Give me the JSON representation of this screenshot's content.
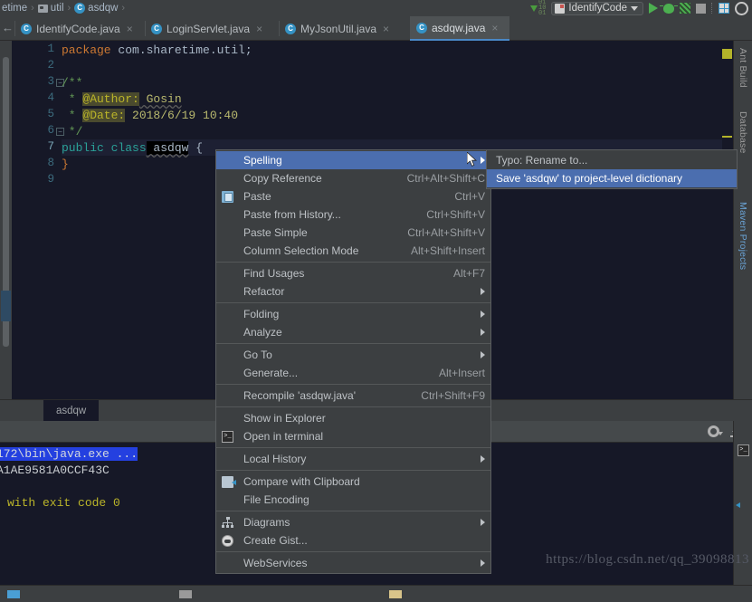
{
  "window": {
    "theme_bg": "#3c3f41",
    "editor_bg": "#161827",
    "accent": "#4b6eaf",
    "tab_accent": "#4a88c7"
  },
  "breadcrumb": {
    "items": [
      {
        "label": "etime",
        "icon": "none"
      },
      {
        "label": "util",
        "icon": "folder-icon"
      },
      {
        "label": "asdqw",
        "icon": "class-icon"
      }
    ],
    "separator": "›"
  },
  "toolbar": {
    "binary_icon": "binary-download-icon",
    "run_config": {
      "name": "IdentifyCode",
      "dropdown": "▼"
    },
    "run_button": "run-icon",
    "debug_button": "debug-icon",
    "coverage_button": "run-with-coverage-icon",
    "stop_button": "stop-icon",
    "layout_button": "grid-layout-icon",
    "search_button": "search-icon"
  },
  "tabs": {
    "back_arrow": "←",
    "items": [
      {
        "label": "IdentifyCode.java",
        "icon": "class-icon",
        "active": false,
        "close": "×"
      },
      {
        "label": "LoginServlet.java",
        "icon": "class-icon",
        "active": false,
        "close": "×"
      },
      {
        "label": "MyJsonUtil.java",
        "icon": "class-icon",
        "active": false,
        "close": "×"
      },
      {
        "label": "asdqw.java",
        "icon": "class-icon",
        "active": true,
        "close": "×"
      }
    ]
  },
  "editor": {
    "line_numbers": [
      "1",
      "2",
      "3",
      "4",
      "5",
      "6",
      "7",
      "8",
      "9"
    ],
    "current_line": 7,
    "code": {
      "l1_kw": "package",
      "l1_pkg": " com.sharetime.util;",
      "l3_doc": "/**",
      "l4_star": " * ",
      "l4_tag": "@Author:",
      "l4_val": " Gosin",
      "l5_star": " * ",
      "l5_tag": "@Date:",
      "l5_val": " 2018/6/19 10:40",
      "l6_doc": " */",
      "l7_kw1": "public",
      "l7_kw2": " class",
      "l7_name": " asdqw",
      "l7_brace": " {",
      "l8": "}"
    },
    "fold_markers": [
      "−",
      "−"
    ]
  },
  "right_toolwindows": {
    "labels": [
      "Ant Build",
      "Database",
      "Maven Projects"
    ]
  },
  "run_window": {
    "tab_label": "asdqw",
    "settings_icon": "gear-icon",
    "export_icon": "export-to-file-icon",
    "console_lines": [
      {
        "text": "172\\bin\\java.exe ...",
        "style": "selected"
      },
      {
        "text": "A1AE9581A0CCF43C",
        "style": "output"
      },
      {
        "text": "",
        "style": "output"
      },
      {
        "text": "with exit code 0",
        "style": "exit"
      }
    ],
    "side_icons": [
      "terminal-icon",
      "compare-icon"
    ]
  },
  "watermark": {
    "text": "https://blog.csdn.net/qq_39098813"
  },
  "context_menu": {
    "items": [
      {
        "label": "Spelling",
        "accel": "",
        "submenu": true,
        "selected": true,
        "icon": "none",
        "underline": ""
      },
      {
        "label": "Copy Reference",
        "accel": "Ctrl+Alt+Shift+C",
        "submenu": false,
        "selected": false,
        "icon": "none",
        "underline": ""
      },
      {
        "label": "Paste",
        "accel": "Ctrl+V",
        "submenu": false,
        "selected": false,
        "icon": "paste-icon",
        "underline": "P"
      },
      {
        "label": "Paste from History...",
        "accel": "Ctrl+Shift+V",
        "submenu": false,
        "selected": false,
        "icon": "none",
        "underline": "e"
      },
      {
        "label": "Paste Simple",
        "accel": "Ctrl+Alt+Shift+V",
        "submenu": false,
        "selected": false,
        "icon": "none",
        "underline": "i"
      },
      {
        "label": "Column Selection Mode",
        "accel": "Alt+Shift+Insert",
        "submenu": false,
        "selected": false,
        "icon": "none",
        "underline": "M"
      },
      {
        "separator": true
      },
      {
        "label": "Find Usages",
        "accel": "Alt+F7",
        "submenu": false,
        "selected": false,
        "icon": "none",
        "underline": "U"
      },
      {
        "label": "Refactor",
        "accel": "",
        "submenu": true,
        "selected": false,
        "icon": "none",
        "underline": "R"
      },
      {
        "separator": true
      },
      {
        "label": "Folding",
        "accel": "",
        "submenu": true,
        "selected": false,
        "icon": "none",
        "underline": ""
      },
      {
        "label": "Analyze",
        "accel": "",
        "submenu": true,
        "selected": false,
        "icon": "none",
        "underline": "z"
      },
      {
        "separator": true
      },
      {
        "label": "Go To",
        "accel": "",
        "submenu": true,
        "selected": false,
        "icon": "none",
        "underline": ""
      },
      {
        "label": "Generate...",
        "accel": "Alt+Insert",
        "submenu": false,
        "selected": false,
        "icon": "none",
        "underline": ""
      },
      {
        "separator": true
      },
      {
        "label": "Recompile 'asdqw.java'",
        "accel": "Ctrl+Shift+F9",
        "submenu": false,
        "selected": false,
        "icon": "none",
        "underline": "e"
      },
      {
        "separator": true
      },
      {
        "label": "Show in Explorer",
        "accel": "",
        "submenu": false,
        "selected": false,
        "icon": "none",
        "underline": ""
      },
      {
        "label": "Open in terminal",
        "accel": "",
        "submenu": false,
        "selected": false,
        "icon": "terminal-icon",
        "underline": ""
      },
      {
        "separator": true
      },
      {
        "label": "Local History",
        "accel": "",
        "submenu": true,
        "selected": false,
        "icon": "none",
        "underline": "H"
      },
      {
        "separator": true
      },
      {
        "label": "Compare with Clipboard",
        "accel": "",
        "submenu": false,
        "selected": false,
        "icon": "compare-clipboard-icon",
        "underline": "b"
      },
      {
        "label": "File Encoding",
        "accel": "",
        "submenu": false,
        "selected": false,
        "icon": "none",
        "underline": ""
      },
      {
        "separator": true
      },
      {
        "label": "Diagrams",
        "accel": "",
        "submenu": true,
        "selected": false,
        "icon": "diagrams-icon",
        "underline": ""
      },
      {
        "label": "Create Gist...",
        "accel": "",
        "submenu": false,
        "selected": false,
        "icon": "gist-icon",
        "underline": ""
      },
      {
        "separator": true
      },
      {
        "label": "WebServices",
        "accel": "",
        "submenu": true,
        "selected": false,
        "icon": "none",
        "underline": "W"
      }
    ]
  },
  "submenu": {
    "items": [
      {
        "label": "Typo: Rename to...",
        "selected": false
      },
      {
        "label": "Save 'asdqw' to project-level dictionary",
        "selected": true
      }
    ]
  }
}
